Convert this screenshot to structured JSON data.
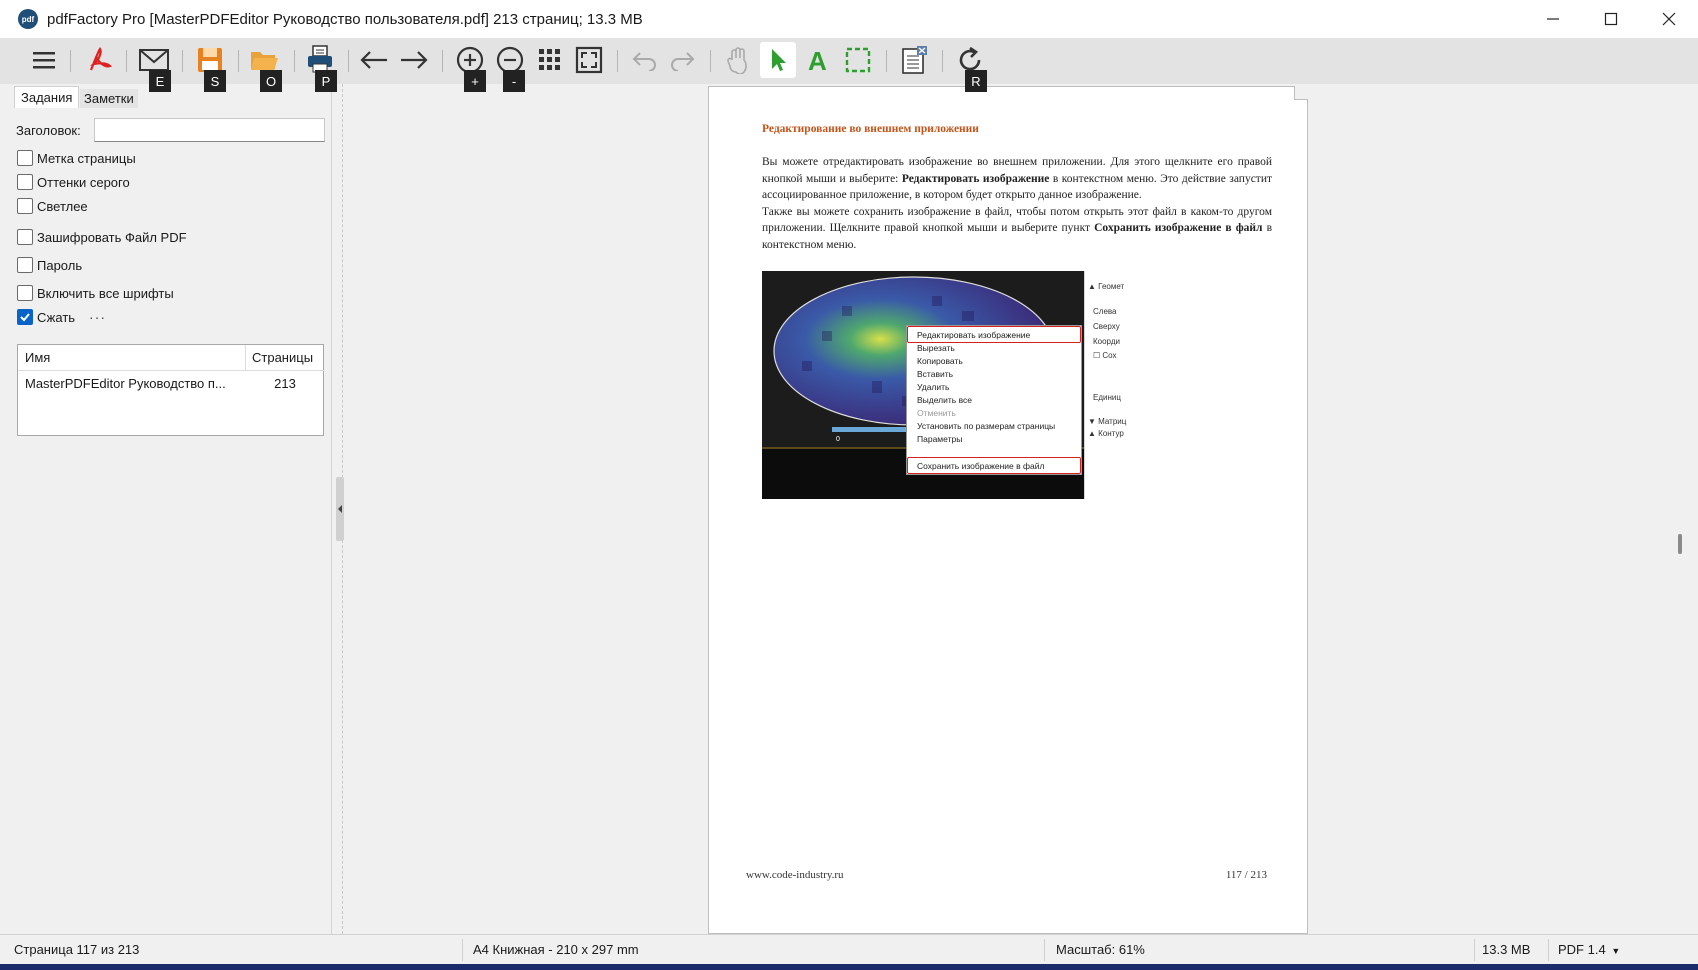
{
  "window": {
    "title": "pdfFactory Pro [MasterPDFEditor Руководство пользователя.pdf] 213 страниц; 13.3 MB",
    "app_icon_text": "pdf"
  },
  "toolbar": {
    "hotkeys": {
      "email": "E",
      "save": "S",
      "open": "O",
      "print": "P",
      "zoom_in": "+",
      "zoom_out": "-",
      "rotate": "R"
    }
  },
  "left_panel": {
    "tabs": [
      "Задания",
      "Заметки"
    ],
    "title_label": "Заголовок:",
    "title_value": "",
    "options": [
      {
        "label": "Метка страницы",
        "checked": false
      },
      {
        "label": "Оттенки серого",
        "checked": false
      },
      {
        "label": "Светлее",
        "checked": false
      },
      {
        "label": "Зашифровать Файл PDF",
        "checked": false
      },
      {
        "label": "Пароль",
        "checked": false
      },
      {
        "label": "Включить все шрифты",
        "checked": false
      },
      {
        "label": "Сжать",
        "checked": true
      }
    ],
    "more_label": "···",
    "table": {
      "col_name": "Имя",
      "col_pages": "Страницы",
      "rows": [
        {
          "name": "MasterPDFEditor Руководство п...",
          "pages": "213"
        }
      ]
    }
  },
  "document": {
    "heading": "Редактирование во внешнем приложении",
    "para1_a": "Вы можете отредактировать изображение во внешнем приложении. Для этого щелкните его правой кнопкой мыши и выберите: ",
    "para1_b": "Редактировать изображение",
    "para1_c": " в контекстном меню. Это действие запустит ассоциированное приложение, в котором будет открыто данное изображение.",
    "para2_a": "Также вы можете сохранить изображение в файл, чтобы потом открыть этот файл в каком-то другом приложении. Щелкните правой кнопкой мыши и выберите пункт ",
    "para2_b": "Сохранить изображение в файл",
    "para2_c": " в контекстном меню.",
    "context_menu": [
      {
        "label": "Редактировать изображение",
        "disabled": false
      },
      {
        "label": "Вырезать",
        "disabled": false
      },
      {
        "label": "Копировать",
        "disabled": false
      },
      {
        "label": "Вставить",
        "disabled": false
      },
      {
        "label": "Удалить",
        "disabled": false
      },
      {
        "label": "Выделить все",
        "disabled": false
      },
      {
        "label": "Отменить",
        "disabled": true
      },
      {
        "label": "Установить по размерам страницы",
        "disabled": false
      },
      {
        "label": "Параметры",
        "disabled": false
      },
      {
        "label": "Сохранить изображение в файл",
        "disabled": false
      }
    ],
    "side_panel": [
      "Геомет",
      "Слева",
      "Сверху",
      "Коорди",
      "Сох",
      "Единиц",
      "Матриц",
      "Контур"
    ],
    "scale_label": "0",
    "footer_left": "www.code-industry.ru",
    "footer_right": "117 / 213"
  },
  "statusbar": {
    "page": "Страница 117 из 213",
    "format": "A4 Книжная - 210 x 297 mm",
    "zoom": "Масштаб: 61%",
    "size": "13.3 MB",
    "pdf_version": "PDF 1.4"
  },
  "colors": {
    "accent": "#0a64c8",
    "heading": "#c5541a",
    "highlight": "#d62020",
    "pdf_red": "#e02020",
    "save_orange": "#e8821e",
    "select_green": "#2e9e2e"
  }
}
